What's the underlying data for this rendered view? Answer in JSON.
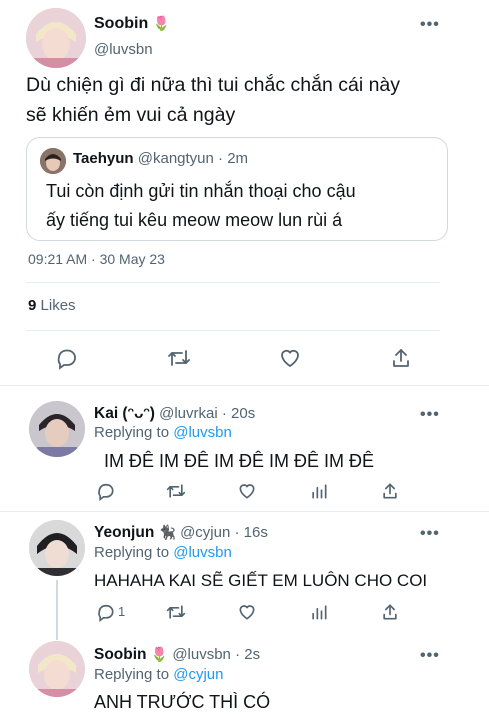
{
  "main_tweet": {
    "author": "Soobin",
    "emoji": "🌷",
    "handle": "@luvsbn",
    "text_line1": "Dù chiện gì đi nữa thì tui chắc chắn cái này",
    "text_line2": "sẽ khiến ẻm vui cả ngày",
    "timestamp": "09:21 AM · 30 May 23",
    "likes_count": "9",
    "likes_label": "Likes"
  },
  "quoted_tweet": {
    "author": "Taehyun",
    "handle": "@kangtyun",
    "time": "· 2m",
    "text_line1": "Tui còn định gửi tin nhắn thoại cho cậu",
    "text_line2": "ấy tiếng tui kêu meow meow lun rùi á"
  },
  "replies": [
    {
      "author": "Kai (ᵔᴗᵔ)",
      "handle": "@luvrkai",
      "time": "· 20s",
      "replying_label": "Replying to",
      "replying_to": "@luvsbn",
      "text": "IM ĐÊ IM ĐÊ IM ĐÊ IM ĐÊ IM ĐÊ",
      "reply_count": ""
    },
    {
      "author": "Yeonjun",
      "emoji": "🐈‍⬛",
      "handle": "@cyjun",
      "time": "· 16s",
      "replying_label": "Replying to",
      "replying_to": "@luvsbn",
      "text": "HAHAHA KAI SẼ GIẾT EM LUÔN CHO COI",
      "reply_count": "1"
    },
    {
      "author": "Soobin",
      "emoji": "🌷",
      "handle": "@luvsbn",
      "time": "· 2s",
      "replying_label": "Replying to",
      "replying_to": "@cyjun",
      "text": "ANH TRƯỚC THÌ CÓ"
    }
  ],
  "more_label": "•••",
  "colors": {
    "link": "#1d9bf0",
    "muted": "#536471",
    "text": "#0f1419",
    "divider": "#e6ecf0"
  }
}
